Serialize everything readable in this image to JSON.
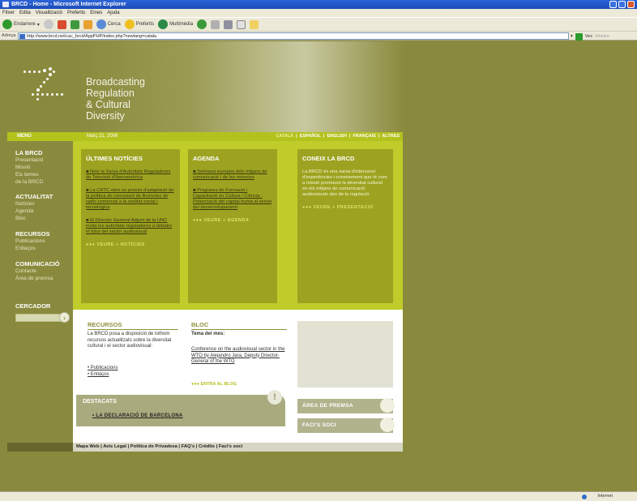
{
  "browser": {
    "title": "BRCD - Home - Microsoft Internet Explorer",
    "menu": [
      "Fitxer",
      "Edita",
      "Visualització",
      "Preferits",
      "Eines",
      "Ajuda"
    ],
    "toolbar": {
      "back": "Endarrere",
      "search": "Cerca",
      "favorites": "Preferits",
      "media": "Multimèdia"
    },
    "address_label": "Adreça",
    "address": "http://www.brcd.net/cac_brcd/AppPHP/index.php?newlang=catala",
    "go": "Ves",
    "links": "Vincles"
  },
  "status_bar": {
    "zone": "Internet"
  },
  "site": {
    "title_lines": [
      "Broadcasting",
      "Regulation",
      "& Cultural",
      "Diversity"
    ],
    "menu_label": "MENÚ",
    "date": "Març 21, 2006",
    "languages": [
      "CATALÀ",
      "ESPAÑOL",
      "ENGLISH",
      "FRANÇAIS",
      "ALTRES"
    ],
    "active_language": "CATALÀ"
  },
  "sidebar": {
    "sections": [
      {
        "heading": "LA BRCD",
        "items": [
          "Presentació",
          "Missió",
          "Els temes",
          "de la BRCD"
        ]
      },
      {
        "heading": "ACTUALITAT",
        "items": [
          "Notícies",
          "Agenda",
          "Bloc"
        ]
      },
      {
        "heading": "RECURSOS",
        "items": [
          "Publicacions",
          "Enllaços"
        ]
      },
      {
        "heading": "COMUNICACIÓ",
        "items": [
          "Contacte",
          "Àrea de premsa"
        ]
      }
    ],
    "search_label": "CERCADOR"
  },
  "boxes": {
    "news": {
      "heading": "ÚLTIMES NOTÍCIES",
      "items": [
        "Neix la Xarxa d'Autoritats Reguladores de Televisió d'Iberoamèrica",
        "La CRTC obre un procés d'adaptació de la política de concessió de llicències de radio comercial a la realitat social i tecnològica",
        "El Director General Adjunt de la UNC invita les autoritats reguladores a debatre el futur del sector audiovisual"
      ],
      "more": "VEURE + NOTÍCIES"
    },
    "agenda": {
      "heading": "AGENDA",
      "items": [
        "Setmana europea dels mitjans de comunicació i de les minories",
        "Programa de Formació i Capacitació en Cultura i Ciència : Potenciació del capital humà al servei del desenvolupament"
      ],
      "more": "VEURE + AGENDA"
    },
    "about": {
      "heading": "CONEIX LA BRCD",
      "text": "La BRCD és una xarxa d'intercanvi d'experiències i coneixement que té com a missió promoure la diversitat cultural en els mitjans de comunicació audiovisuals des de la regulació.",
      "more": "VEURE + PRESENTACIÓ"
    }
  },
  "resources": {
    "heading": "RECURSOS",
    "text": "La BRCD posa a disposició de tothom recursos actualitzats sobre la diversitat cultural i el sector audiovisual:",
    "links": [
      "Publicacions",
      "Enllaços"
    ]
  },
  "blog": {
    "heading": "BLOC",
    "subheading": "Tema del mes:",
    "link": "Conference on the audiovisual sector in the WTO by Alejandro Jara, Deputy Director-General of the WTO",
    "more": "ENTRA AL BLOG"
  },
  "highlights": {
    "heading": "DESTACATS",
    "link": "LA DECLARACIÓ DE BARCELONA"
  },
  "right_buttons": [
    "ÀREA DE PREMSA",
    "FACI'S SOCI"
  ],
  "footer": "Mapa Web | Avís Legal | Política de Privadesa | FAQ's | Crèdits | Faci's soci"
}
